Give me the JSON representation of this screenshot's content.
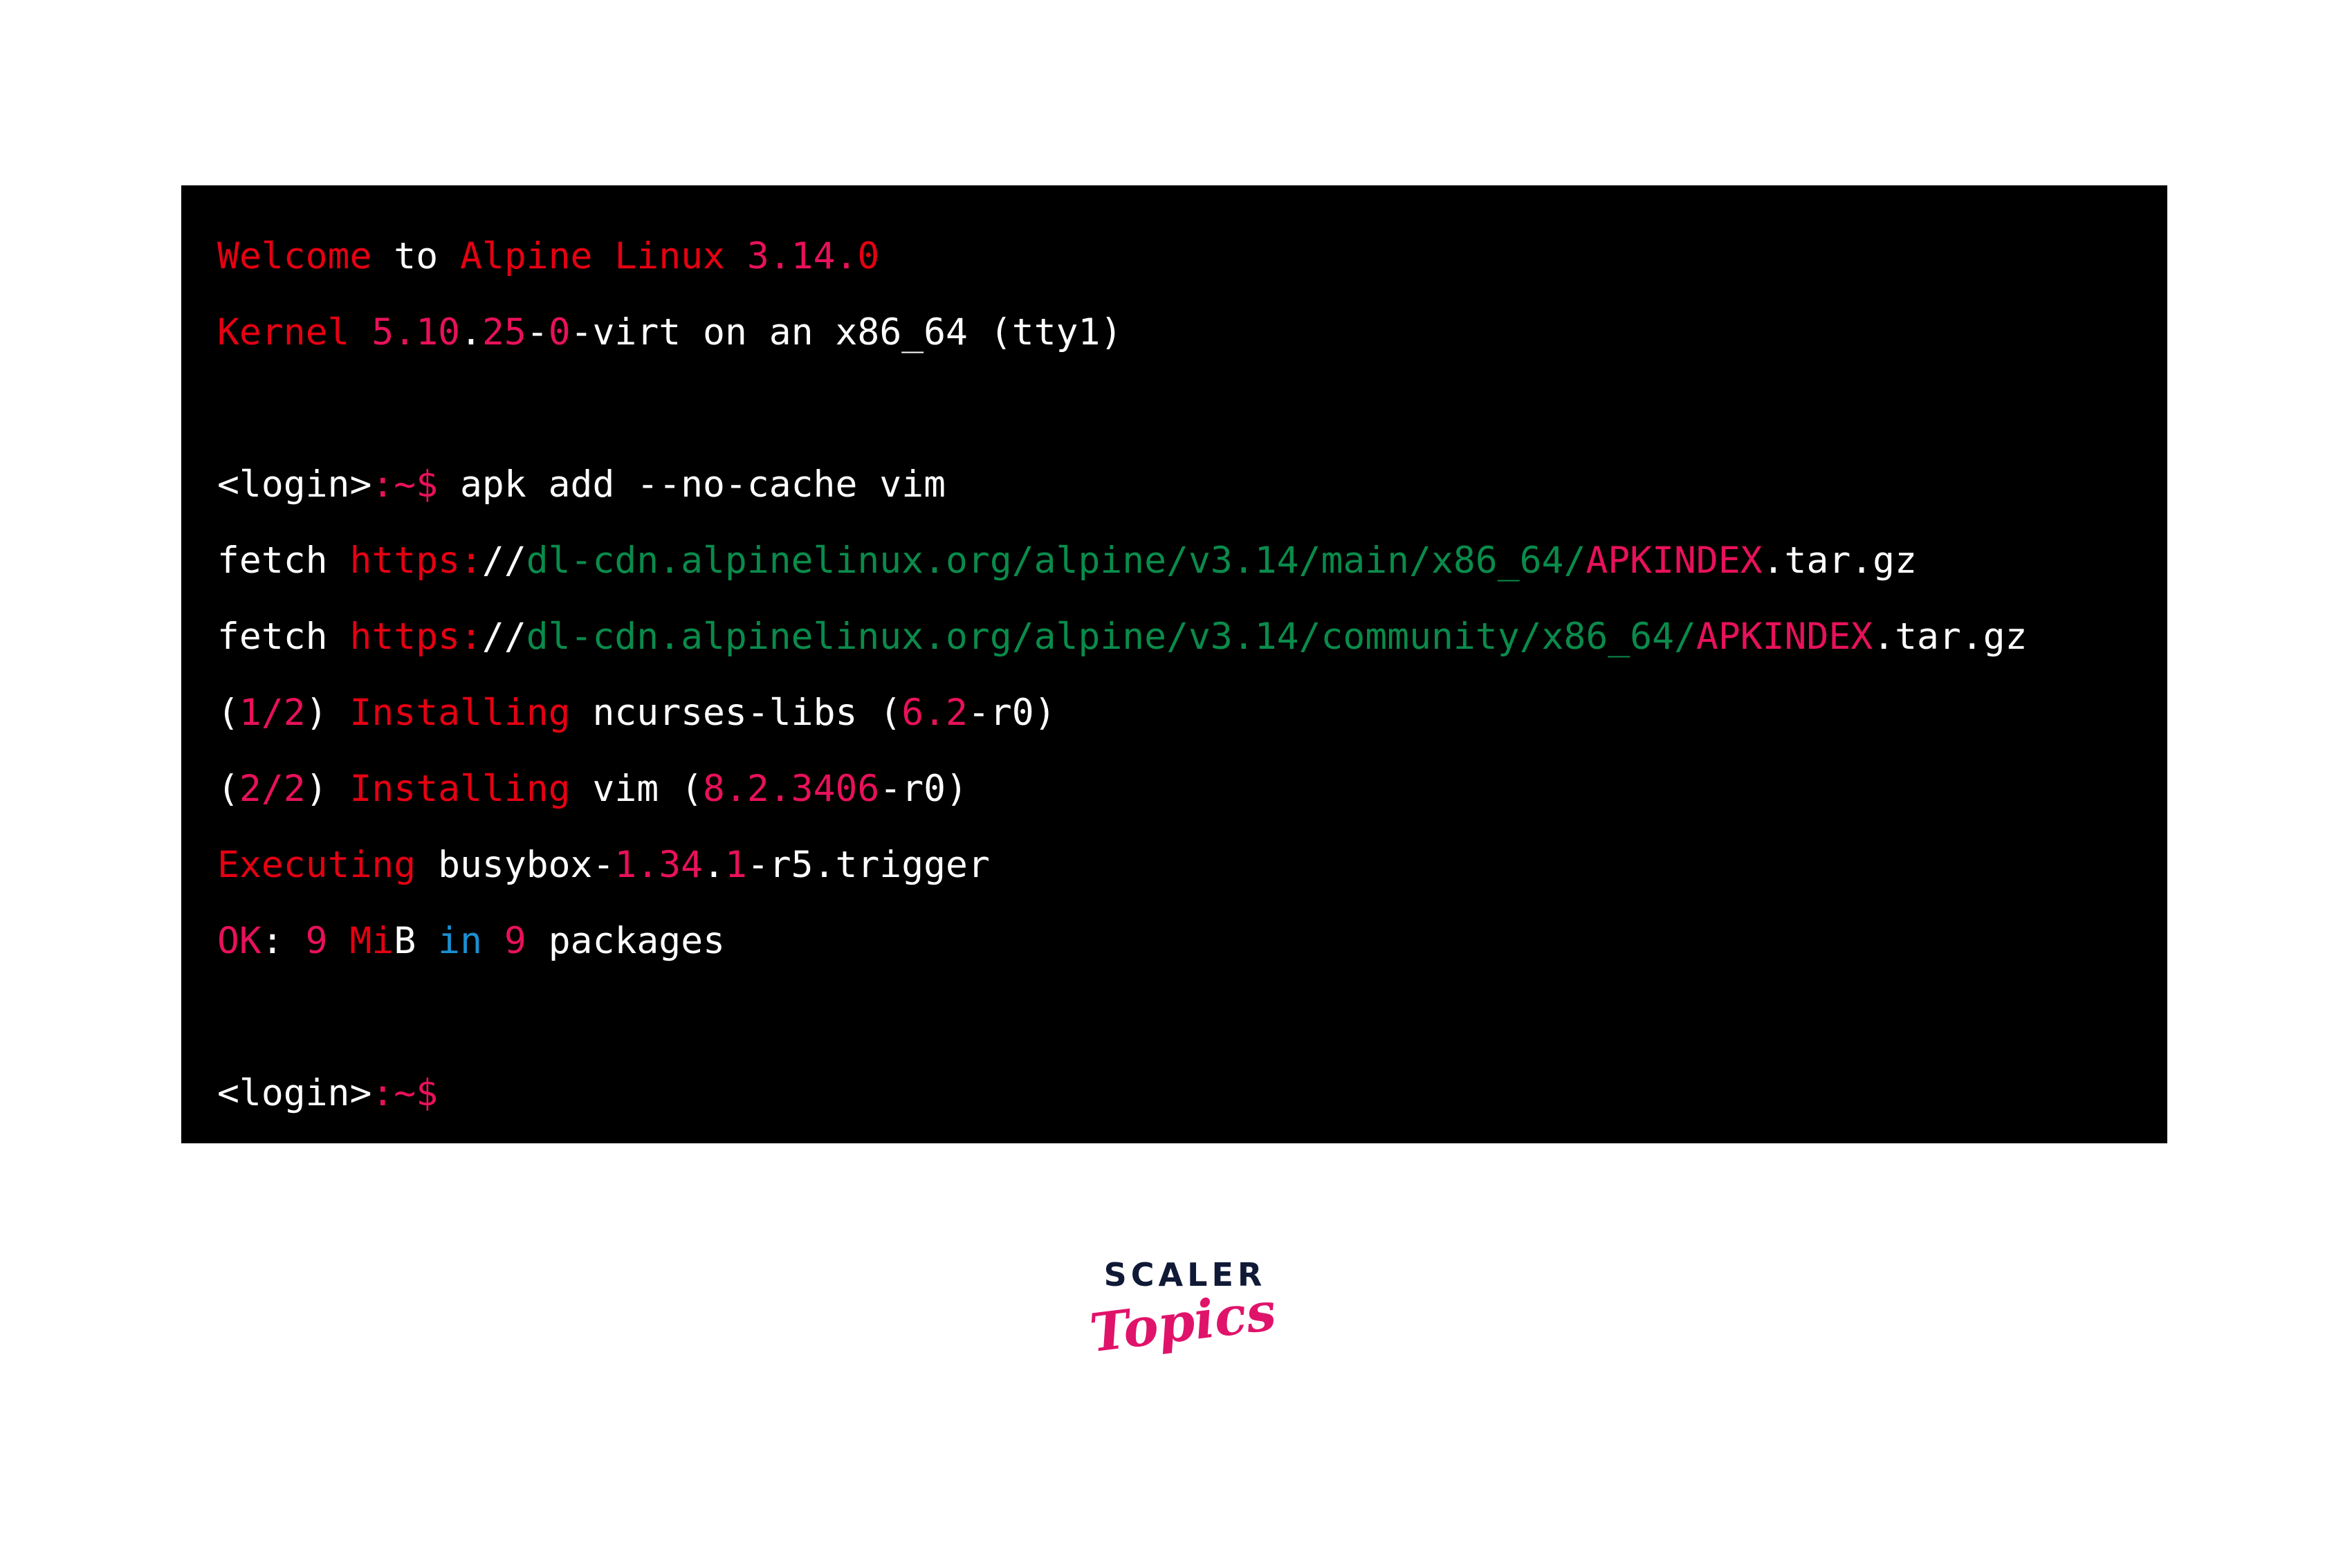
{
  "page": {
    "background_color": "#ffffff",
    "terminal_background": "#000000"
  },
  "palette": {
    "white": "#ffffff",
    "red": "#e60012",
    "pink": "#e8115b",
    "green": "#0a8b4b",
    "blue": "#1b8fd1",
    "logo_navy": "#101a36",
    "logo_pink": "#e0136a"
  },
  "terminal": {
    "name": "alpine-linux-console",
    "lines": [
      {
        "id": "welcome",
        "segments": [
          {
            "text": "Welcome",
            "color": "red"
          },
          {
            "text": " to ",
            "color": "white"
          },
          {
            "text": "Alpine Linux ",
            "color": "red"
          },
          {
            "text": "3.14",
            "color": "pink"
          },
          {
            "text": ".",
            "color": "pink"
          },
          {
            "text": "0",
            "color": "red"
          }
        ]
      },
      {
        "id": "kernel",
        "segments": [
          {
            "text": "Kernel ",
            "color": "red"
          },
          {
            "text": "5.10",
            "color": "pink"
          },
          {
            "text": ".",
            "color": "white"
          },
          {
            "text": "25",
            "color": "pink"
          },
          {
            "text": "-",
            "color": "white"
          },
          {
            "text": "0",
            "color": "pink"
          },
          {
            "text": "-virt on an x86_64 (tty1)",
            "color": "white"
          }
        ]
      },
      {
        "id": "blank-1",
        "segments": [
          {
            "text": " ",
            "color": "white"
          }
        ]
      },
      {
        "id": "prompt-command",
        "segments": [
          {
            "text": "<login>",
            "color": "white"
          },
          {
            "text": ":~$",
            "color": "pink"
          },
          {
            "text": " apk add --no-cache vim",
            "color": "white"
          }
        ]
      },
      {
        "id": "fetch-main",
        "segments": [
          {
            "text": "fetch ",
            "color": "white"
          },
          {
            "text": "https:",
            "color": "red"
          },
          {
            "text": "//",
            "color": "white"
          },
          {
            "text": "dl-cdn.alpinelinux.org/alpine/v3.14/main/x86_64/",
            "color": "green"
          },
          {
            "text": "APKINDEX",
            "color": "pink"
          },
          {
            "text": ".tar.gz",
            "color": "white"
          }
        ]
      },
      {
        "id": "fetch-community",
        "segments": [
          {
            "text": "fetch ",
            "color": "white"
          },
          {
            "text": "https:",
            "color": "red"
          },
          {
            "text": "//",
            "color": "white"
          },
          {
            "text": "dl-cdn.alpinelinux.org/alpine/v3.14/community/x86_64/",
            "color": "green"
          },
          {
            "text": "APKINDEX",
            "color": "pink"
          },
          {
            "text": ".tar.gz",
            "color": "white"
          }
        ]
      },
      {
        "id": "install-ncurses",
        "segments": [
          {
            "text": "(",
            "color": "white"
          },
          {
            "text": "1/2",
            "color": "pink"
          },
          {
            "text": ") ",
            "color": "white"
          },
          {
            "text": "Installing ",
            "color": "red"
          },
          {
            "text": "ncurses-libs (",
            "color": "white"
          },
          {
            "text": "6.2",
            "color": "pink"
          },
          {
            "text": "-r0)",
            "color": "white"
          }
        ]
      },
      {
        "id": "install-vim",
        "segments": [
          {
            "text": "(",
            "color": "white"
          },
          {
            "text": "2/2",
            "color": "pink"
          },
          {
            "text": ") ",
            "color": "white"
          },
          {
            "text": "Installing ",
            "color": "red"
          },
          {
            "text": "vim (",
            "color": "white"
          },
          {
            "text": "8.2.3406",
            "color": "pink"
          },
          {
            "text": "-r0)",
            "color": "white"
          }
        ]
      },
      {
        "id": "executing-trigger",
        "segments": [
          {
            "text": "Executing ",
            "color": "red"
          },
          {
            "text": "busybox-",
            "color": "white"
          },
          {
            "text": "1.34",
            "color": "pink"
          },
          {
            "text": ".",
            "color": "white"
          },
          {
            "text": "1",
            "color": "pink"
          },
          {
            "text": "-r5.trigger",
            "color": "white"
          }
        ]
      },
      {
        "id": "ok-summary",
        "segments": [
          {
            "text": "OK",
            "color": "pink"
          },
          {
            "text": ": ",
            "color": "white"
          },
          {
            "text": "9",
            "color": "pink"
          },
          {
            "text": " ",
            "color": "white"
          },
          {
            "text": "Mi",
            "color": "red"
          },
          {
            "text": "B",
            "color": "white"
          },
          {
            "text": " ",
            "color": "white"
          },
          {
            "text": "in",
            "color": "blue"
          },
          {
            "text": " ",
            "color": "white"
          },
          {
            "text": "9",
            "color": "pink"
          },
          {
            "text": " packages",
            "color": "white"
          }
        ]
      },
      {
        "id": "blank-2",
        "segments": [
          {
            "text": " ",
            "color": "white"
          }
        ]
      },
      {
        "id": "prompt-final",
        "segments": [
          {
            "text": "<login>",
            "color": "white"
          },
          {
            "text": ":~$",
            "color": "pink"
          }
        ]
      }
    ]
  },
  "logo": {
    "wordmark": "SCALER",
    "script": "Topics"
  }
}
